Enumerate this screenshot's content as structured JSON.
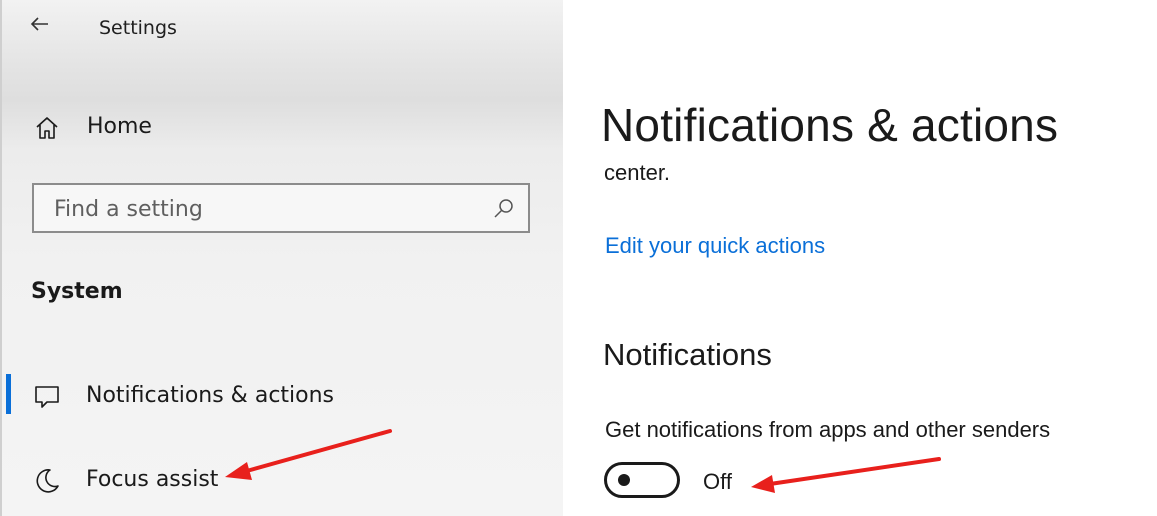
{
  "window": {
    "title": "Settings"
  },
  "sidebar": {
    "home_label": "Home",
    "search": {
      "placeholder": "Find a setting",
      "value": ""
    },
    "section_title": "System",
    "items": [
      {
        "label": "Notifications & actions",
        "icon": "message-icon",
        "selected": true
      },
      {
        "label": "Focus assist",
        "icon": "moon-icon",
        "selected": false
      }
    ]
  },
  "main": {
    "page_title": "Notifications & actions",
    "clipped_text": "center.",
    "quick_actions_link": "Edit your quick actions",
    "notifications_header": "Notifications",
    "get_notifications": {
      "label": "Get notifications from apps and other senders",
      "state": "Off",
      "on": false
    }
  },
  "colors": {
    "accent": "#0a6fd8",
    "annotation_arrow": "#e8201c",
    "sidebar_bg": "#f2f2f2"
  },
  "annotations": [
    {
      "type": "arrow",
      "target": "Focus assist"
    },
    {
      "type": "arrow",
      "target": "Off"
    }
  ]
}
